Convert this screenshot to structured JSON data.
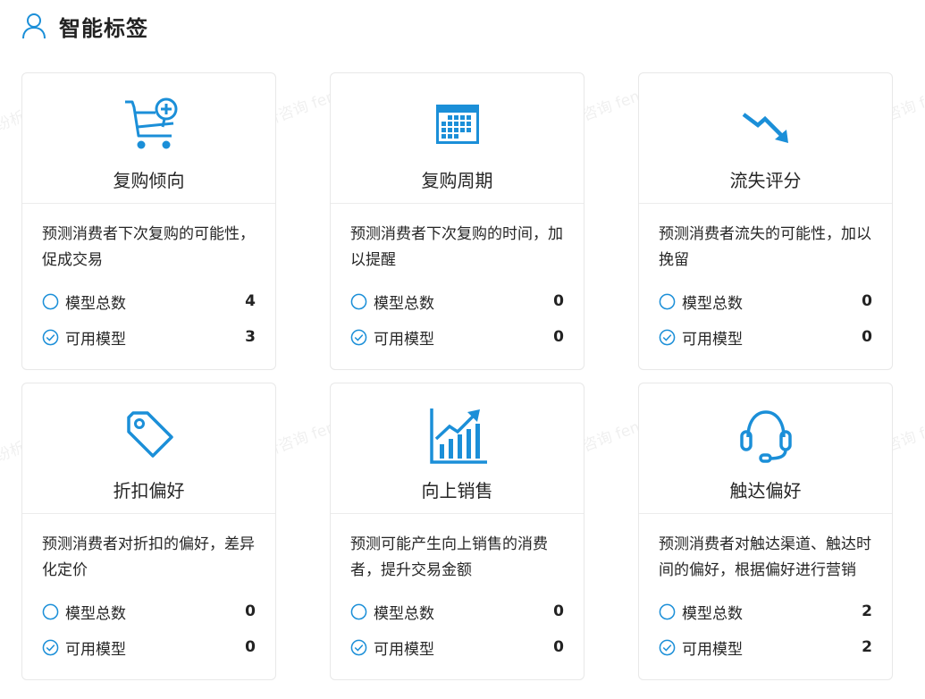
{
  "page": {
    "title": "智能标签"
  },
  "colors": {
    "accent": "#1b8fd8",
    "text": "#262626",
    "border": "#e8e8e8"
  },
  "watermark": "纷析咨询 fenxi_trial",
  "stat_labels": {
    "total": "模型总数",
    "available": "可用模型"
  },
  "cards": [
    {
      "name": "复购倾向",
      "icon": "cart-plus-icon",
      "desc": "预测消费者下次复购的可能性，促成交易",
      "total": "4",
      "available": "3"
    },
    {
      "name": "复购周期",
      "icon": "calendar-icon",
      "desc": "预测消费者下次复购的时间，加以提醒",
      "total": "0",
      "available": "0"
    },
    {
      "name": "流失评分",
      "icon": "trend-down-icon",
      "desc": "预测消费者流失的可能性，加以挽留",
      "total": "0",
      "available": "0"
    },
    {
      "name": "折扣偏好",
      "icon": "price-tag-icon",
      "desc": "预测消费者对折扣的偏好，差异化定价",
      "total": "0",
      "available": "0"
    },
    {
      "name": "向上销售",
      "icon": "bar-chart-up-icon",
      "desc": "预测可能产生向上销售的消费者，提升交易金额",
      "total": "0",
      "available": "0"
    },
    {
      "name": "触达偏好",
      "icon": "headset-icon",
      "desc": "预测消费者对触达渠道、触达时间的偏好，根据偏好进行营销",
      "total": "2",
      "available": "2"
    }
  ]
}
